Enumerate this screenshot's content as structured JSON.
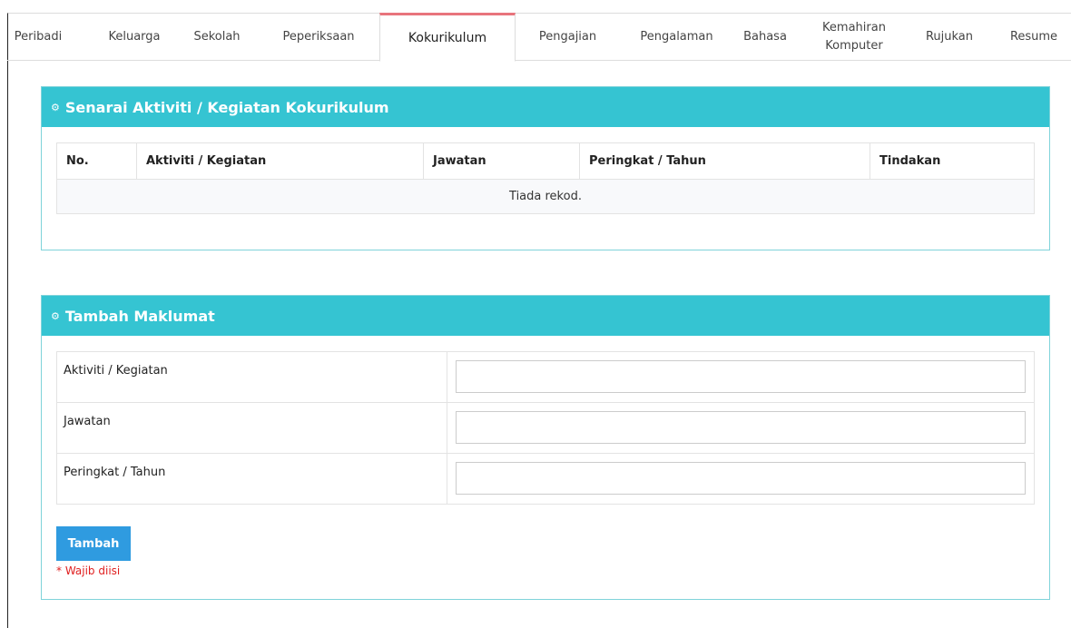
{
  "tabs": [
    {
      "label": "Peribadi"
    },
    {
      "label": "Keluarga"
    },
    {
      "label": "Sekolah"
    },
    {
      "label": "Peperiksaan"
    },
    {
      "label": "Kokurikulum",
      "active": true
    },
    {
      "label": "Pengajian"
    },
    {
      "label": "Pengalaman"
    },
    {
      "label": "Bahasa"
    },
    {
      "label": "Kemahiran Komputer"
    },
    {
      "label": "Rujukan"
    },
    {
      "label": "Resume"
    }
  ],
  "list_panel": {
    "title": "Senarai Aktiviti / Kegiatan Kokurikulum",
    "columns": [
      "No.",
      "Aktiviti / Kegiatan",
      "Jawatan",
      "Peringkat / Tahun",
      "Tindakan"
    ],
    "empty_text": "Tiada rekod."
  },
  "form_panel": {
    "title": "Tambah Maklumat",
    "fields": [
      {
        "label": "Aktiviti / Kegiatan",
        "value": ""
      },
      {
        "label": "Jawatan",
        "value": ""
      },
      {
        "label": "Peringkat / Tahun",
        "value": ""
      }
    ],
    "submit_label": "Tambah",
    "required_note": "* Wajib diisi"
  },
  "colors": {
    "panel_header": "#35c4d2",
    "panel_border": "#7fd3da",
    "active_tab_accent": "#e8747c",
    "button": "#2f9be0",
    "required_text": "#e02020"
  },
  "icons": {
    "panel_header": "gears-icon"
  }
}
